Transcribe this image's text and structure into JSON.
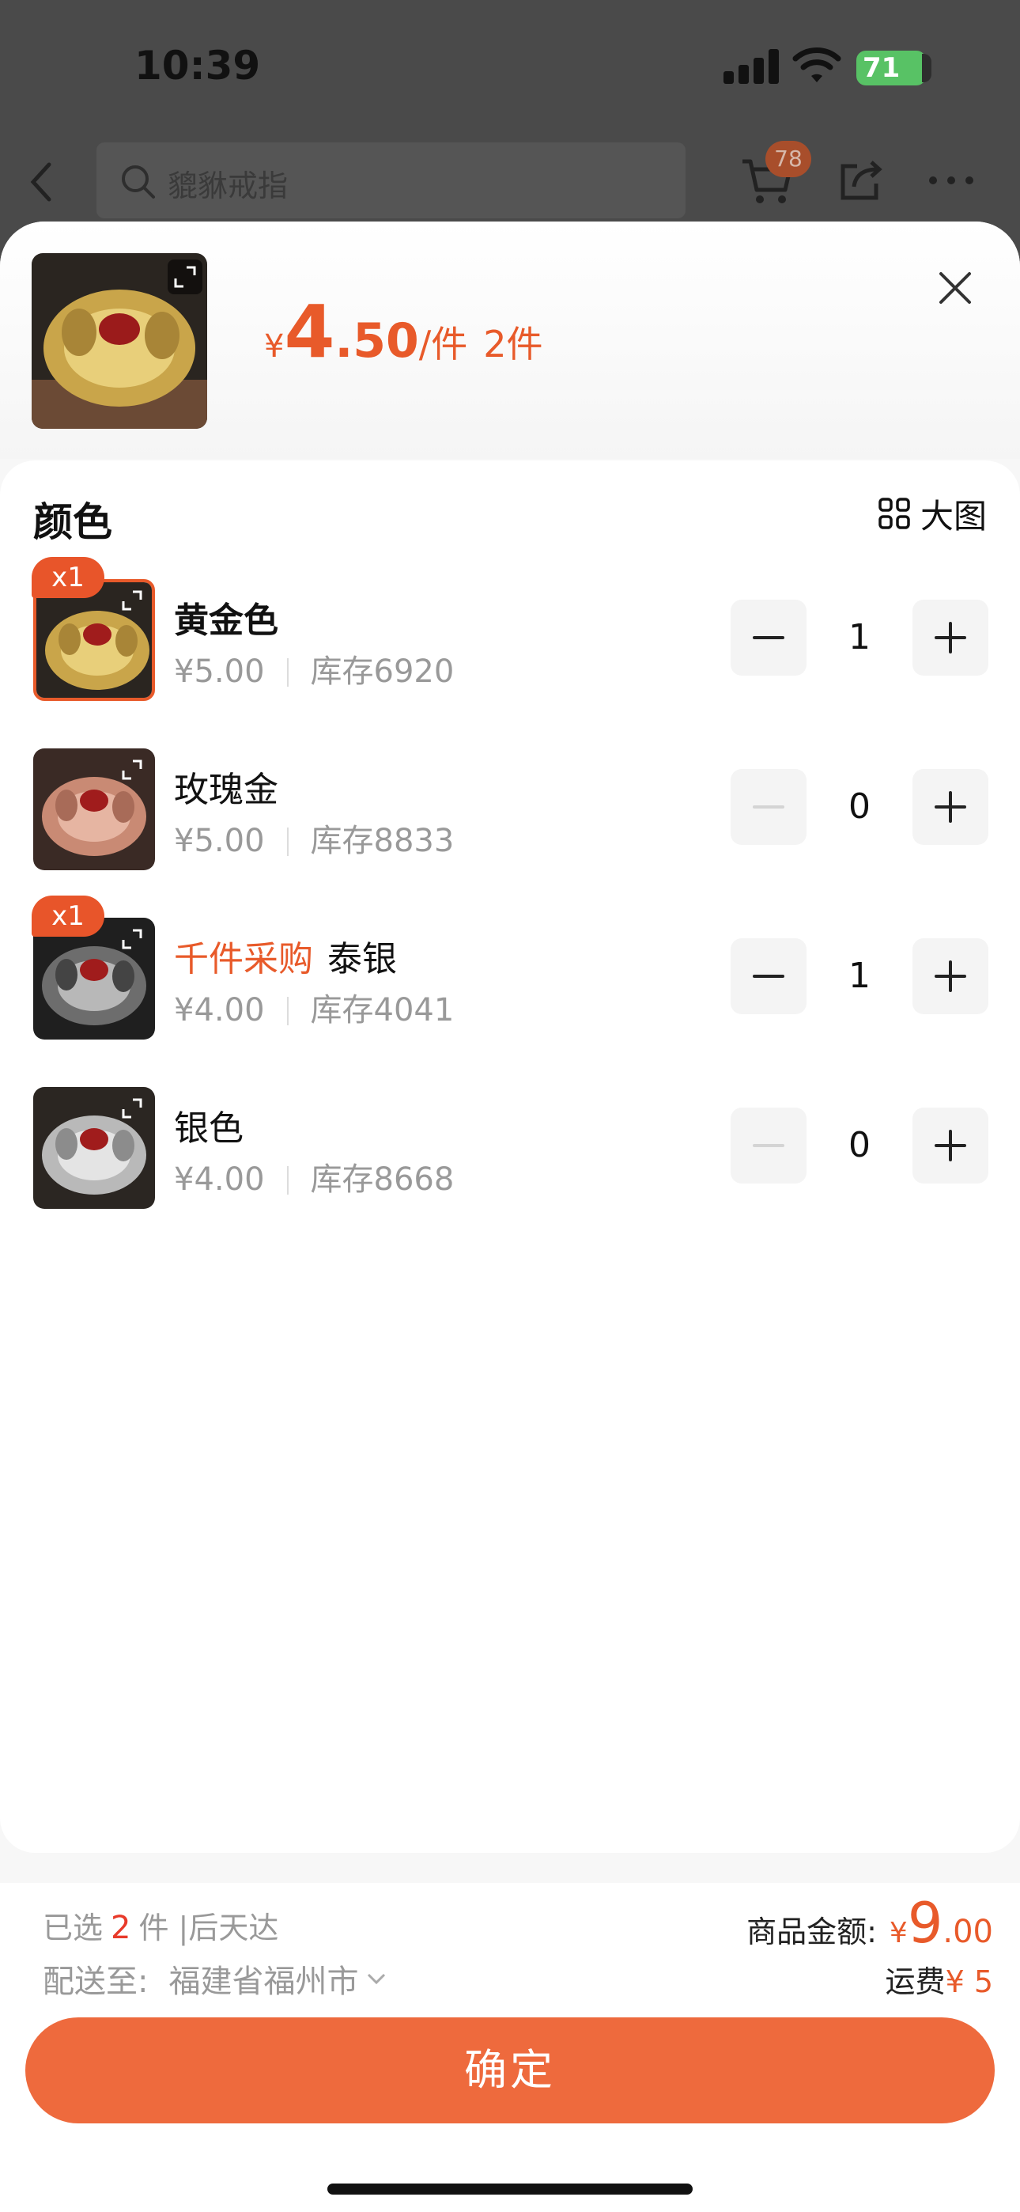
{
  "status_bar": {
    "time": "10:39",
    "battery": "71"
  },
  "nav": {
    "search_text": "貔貅戒指",
    "cart_count": "78"
  },
  "sheet": {
    "price_currency": "¥",
    "price_int": "4",
    "price_dec": ".50",
    "price_unit": "/件",
    "item_count": "2件",
    "section_title": "颜色",
    "big_image_label": "大图"
  },
  "variants": [
    {
      "name": "黄金色",
      "tag": "",
      "price": "¥5.00",
      "stock": "库存6920",
      "qty": "1",
      "badge": "x1",
      "tone": "gold"
    },
    {
      "name": "玫瑰金",
      "tag": "",
      "price": "¥5.00",
      "stock": "库存8833",
      "qty": "0",
      "badge": "",
      "tone": "rose"
    },
    {
      "name": "泰银",
      "tag": "千件采购",
      "price": "¥4.00",
      "stock": "库存4041",
      "qty": "1",
      "badge": "x1",
      "tone": "thai"
    },
    {
      "name": "银色",
      "tag": "",
      "price": "¥4.00",
      "stock": "库存8668",
      "qty": "0",
      "badge": "",
      "tone": "silver"
    }
  ],
  "footer": {
    "selected_prefix": "已选",
    "selected_count": "2",
    "selected_suffix": "件 |后天达",
    "ship_label": "配送至:",
    "ship_address": "福建省福州市",
    "total_label": "商品金额:",
    "total_currency": "¥",
    "total_int": "9",
    "total_dec": ".00",
    "fee_label": "运费",
    "fee_value": "¥ 5",
    "confirm_label": "确定"
  },
  "colors": {
    "accent": "#e85a2a",
    "button": "#ee6a3d"
  }
}
